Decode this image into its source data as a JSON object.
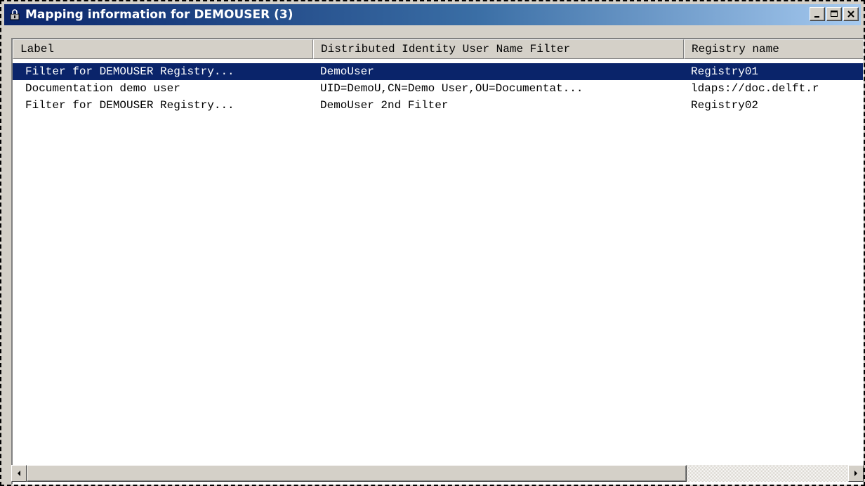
{
  "window": {
    "title": "Mapping information for DEMOUSER (3)",
    "icon": "padlock-icon",
    "buttons": [
      "minimize",
      "maximize",
      "close"
    ]
  },
  "list": {
    "columns": [
      "Label",
      "Distributed Identity User Name Filter",
      "Registry name"
    ],
    "rows": [
      {
        "label": "Filter for DEMOUSER Registry...",
        "filter": "DemoUser",
        "registry": "Registry01",
        "selected": true
      },
      {
        "label": "Documentation demo user",
        "filter": "UID=DemoU,CN=Demo User,OU=Documentat...",
        "registry": "ldaps://doc.delft.r",
        "selected": false
      },
      {
        "label": "Filter for DEMOUSER Registry...",
        "filter": "DemoUser 2nd Filter",
        "registry": "Registry02",
        "selected": false
      }
    ]
  },
  "colors": {
    "selection": "#0a246a",
    "title_gradient_start": "#0a246a",
    "title_gradient_end": "#a6caf0",
    "face": "#d4d0c8"
  }
}
